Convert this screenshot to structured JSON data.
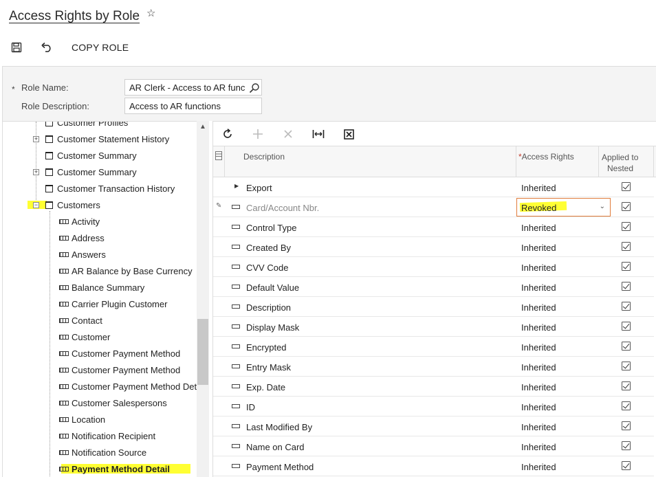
{
  "page": {
    "title": "Access Rights by Role"
  },
  "toolbar": {
    "copy_role_label": "COPY ROLE"
  },
  "form": {
    "role_name_label": "Role Name:",
    "role_name_required": "*",
    "role_name_value": "AR Clerk - Access to AR func",
    "role_description_label": "Role Description:",
    "role_description_value": "Access to AR functions"
  },
  "tree": {
    "items": [
      {
        "label": "Customer Profiles",
        "type": "screen"
      },
      {
        "label": "Customer Statement History",
        "type": "screen",
        "expander": "+"
      },
      {
        "label": "Customer Summary",
        "type": "screen"
      },
      {
        "label": "Customer Summary",
        "type": "screen",
        "expander": "+"
      },
      {
        "label": "Customer Transaction History",
        "type": "screen"
      },
      {
        "label": "Customers",
        "type": "screen",
        "expander": "−",
        "highlighted": true
      },
      {
        "label": "Activity",
        "type": "field"
      },
      {
        "label": "Address",
        "type": "field"
      },
      {
        "label": "Answers",
        "type": "field"
      },
      {
        "label": "AR Balance by Base Currency",
        "type": "field"
      },
      {
        "label": "Balance Summary",
        "type": "field"
      },
      {
        "label": "Carrier Plugin Customer",
        "type": "field"
      },
      {
        "label": "Contact",
        "type": "field"
      },
      {
        "label": "Customer",
        "type": "field"
      },
      {
        "label": "Customer Payment Method",
        "type": "field"
      },
      {
        "label": "Customer Payment Method",
        "type": "field"
      },
      {
        "label": "Customer Payment Method Det",
        "type": "field"
      },
      {
        "label": "Customer Salespersons",
        "type": "field"
      },
      {
        "label": "Location",
        "type": "field"
      },
      {
        "label": "Notification Recipient",
        "type": "field"
      },
      {
        "label": "Notification Source",
        "type": "field"
      },
      {
        "label": "Payment Method Detail",
        "type": "field",
        "highlighted": true,
        "bold": true
      }
    ]
  },
  "grid": {
    "headers": {
      "description": "Description",
      "access_rights_required": "*",
      "access_rights": "Access Rights",
      "applied_line1": "Applied to",
      "applied_line2": "Nested"
    },
    "rows": [
      {
        "description": "Export",
        "rights": "Inherited",
        "applied": true,
        "kind": "group"
      },
      {
        "description": "Card/Account Nbr.",
        "rights": "Revoked",
        "applied": true,
        "kind": "field",
        "editing": true
      },
      {
        "description": "Control Type",
        "rights": "Inherited",
        "applied": true,
        "kind": "field"
      },
      {
        "description": "Created By",
        "rights": "Inherited",
        "applied": true,
        "kind": "field"
      },
      {
        "description": "CVV Code",
        "rights": "Inherited",
        "applied": true,
        "kind": "field"
      },
      {
        "description": "Default Value",
        "rights": "Inherited",
        "applied": true,
        "kind": "field"
      },
      {
        "description": "Description",
        "rights": "Inherited",
        "applied": true,
        "kind": "field"
      },
      {
        "description": "Display Mask",
        "rights": "Inherited",
        "applied": true,
        "kind": "field"
      },
      {
        "description": "Encrypted",
        "rights": "Inherited",
        "applied": true,
        "kind": "field"
      },
      {
        "description": "Entry Mask",
        "rights": "Inherited",
        "applied": true,
        "kind": "field"
      },
      {
        "description": "Exp. Date",
        "rights": "Inherited",
        "applied": true,
        "kind": "field"
      },
      {
        "description": "ID",
        "rights": "Inherited",
        "applied": true,
        "kind": "field"
      },
      {
        "description": "Last Modified By",
        "rights": "Inherited",
        "applied": true,
        "kind": "field"
      },
      {
        "description": "Name on Card",
        "rights": "Inherited",
        "applied": true,
        "kind": "field"
      },
      {
        "description": "Payment Method",
        "rights": "Inherited",
        "applied": true,
        "kind": "field"
      }
    ]
  },
  "colors": {
    "highlight": "#ffff33",
    "focus_border": "#e07b39",
    "required": "#c0392b"
  }
}
